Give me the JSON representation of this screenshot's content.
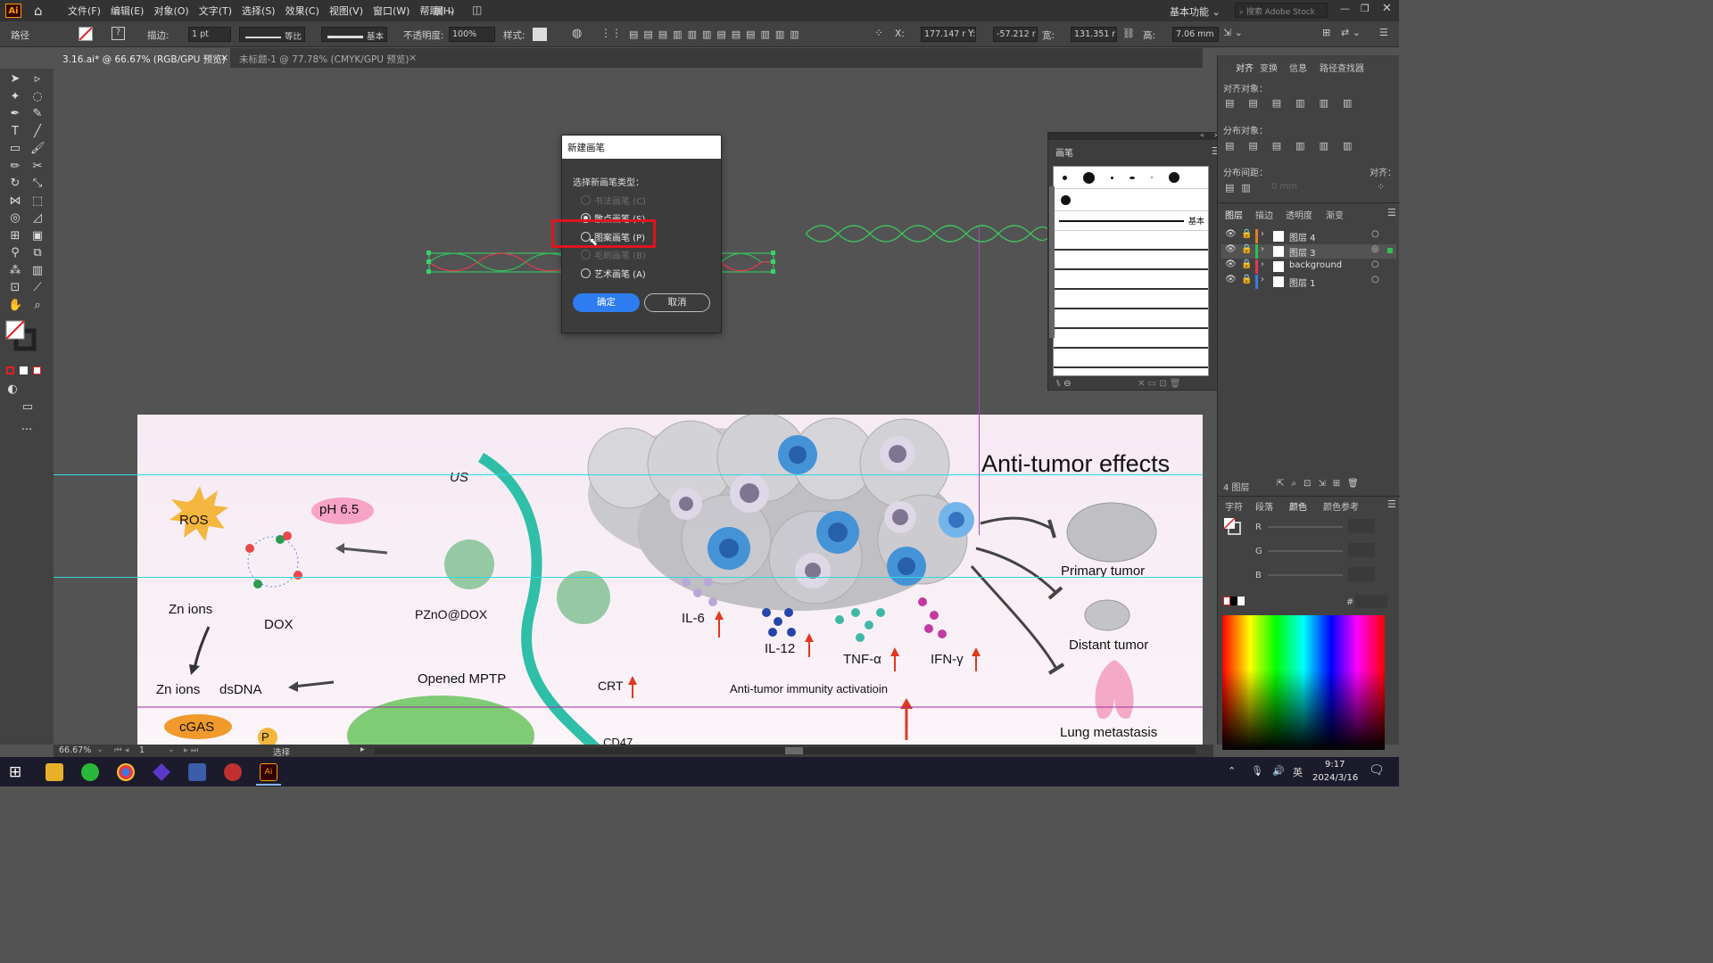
{
  "app": {
    "logo": "Ai",
    "menu": [
      "文件(F)",
      "编辑(E)",
      "对象(O)",
      "文字(T)",
      "选择(S)",
      "效果(C)",
      "视图(V)",
      "窗口(W)",
      "帮助(H)"
    ],
    "workspace": "基本功能",
    "search_placeholder": "搜索 Adobe Stock"
  },
  "control_bar": {
    "object_type": "路径",
    "stroke_label": "描边:",
    "stroke_value": "1 pt",
    "stroke_profile": "等比",
    "brush_def": "基本",
    "opacity_label": "不透明度:",
    "opacity_value": "100%",
    "style_label": "样式:",
    "x_label": "X:",
    "x_value": "177.147 r",
    "y_label": "Y:",
    "y_value": "-57.212 r",
    "w_label": "宽:",
    "w_value": "131.351 r",
    "h_label": "高:",
    "h_value": "7.06 mm"
  },
  "tabs": [
    {
      "label": "3.16.ai* @ 66.67% (RGB/GPU 预览)",
      "close": "×"
    },
    {
      "label": "未标题-1 @ 77.78% (CMYK/GPU 预览)",
      "close": "×"
    }
  ],
  "dialog": {
    "title": "新建画笔",
    "prompt": "选择新画笔类型：",
    "options": [
      {
        "label": "书法画笔 (C)",
        "enabled": false,
        "checked": false
      },
      {
        "label": "散点画笔 (S)",
        "enabled": true,
        "checked": true
      },
      {
        "label": "图案画笔 (P)",
        "enabled": true,
        "checked": false
      },
      {
        "label": "毛刷画笔 (B)",
        "enabled": false,
        "checked": false
      },
      {
        "label": "艺术画笔 (A)",
        "enabled": true,
        "checked": false
      }
    ],
    "ok": "确定",
    "cancel": "取消",
    "highlight_color": "#e0141e"
  },
  "brush_panel": {
    "title": "画笔",
    "basic_label": "基本"
  },
  "right_dock": {
    "tabs_top": [
      "对齐",
      "变换",
      "信息",
      "路径查找器"
    ],
    "align_objects": "对齐对象：",
    "distribute_objects": "分布对象：",
    "distribute_spacing": "分布间距：",
    "align_to": "对齐：",
    "spacing_value": "0 mm",
    "tabs_layers": [
      "图层",
      "描边",
      "透明度",
      "渐变"
    ],
    "layers": [
      "图层 4",
      "图层 3",
      "background",
      "图层 1"
    ],
    "layers_count": "4 图层",
    "tabs_color": [
      "字符",
      "段落",
      "颜色",
      "颜色参考"
    ],
    "rgb_labels": [
      "R",
      "G",
      "B"
    ],
    "hex_label": "#"
  },
  "artboard": {
    "title": "Anti-tumor effects",
    "labels": {
      "us": "US",
      "ros": "ROS",
      "ph": "pH 6.5",
      "zn1": "Zn ions",
      "dox": "DOX",
      "pzno": "PZnO@DOX",
      "zn2": "Zn ions",
      "dsdna": "dsDNA",
      "mptp": "Opened MPTP",
      "cgas": "cGAS",
      "p": "P",
      "crt": "CRT",
      "cd47": "CD47",
      "il6": "IL-6",
      "il12": "IL-12",
      "tnf": "TNF-α",
      "ifn": "IFN-γ",
      "immunity": "Anti-tumor immunity activatioin",
      "primary": "Primary tumor",
      "distant": "Distant tumor",
      "lung": "Lung metastasis"
    }
  },
  "status": {
    "zoom": "66.67%",
    "page": "1",
    "tool": "选择"
  },
  "taskbar": {
    "time": "9:17",
    "date": "2024/3/16",
    "ime": "英"
  }
}
